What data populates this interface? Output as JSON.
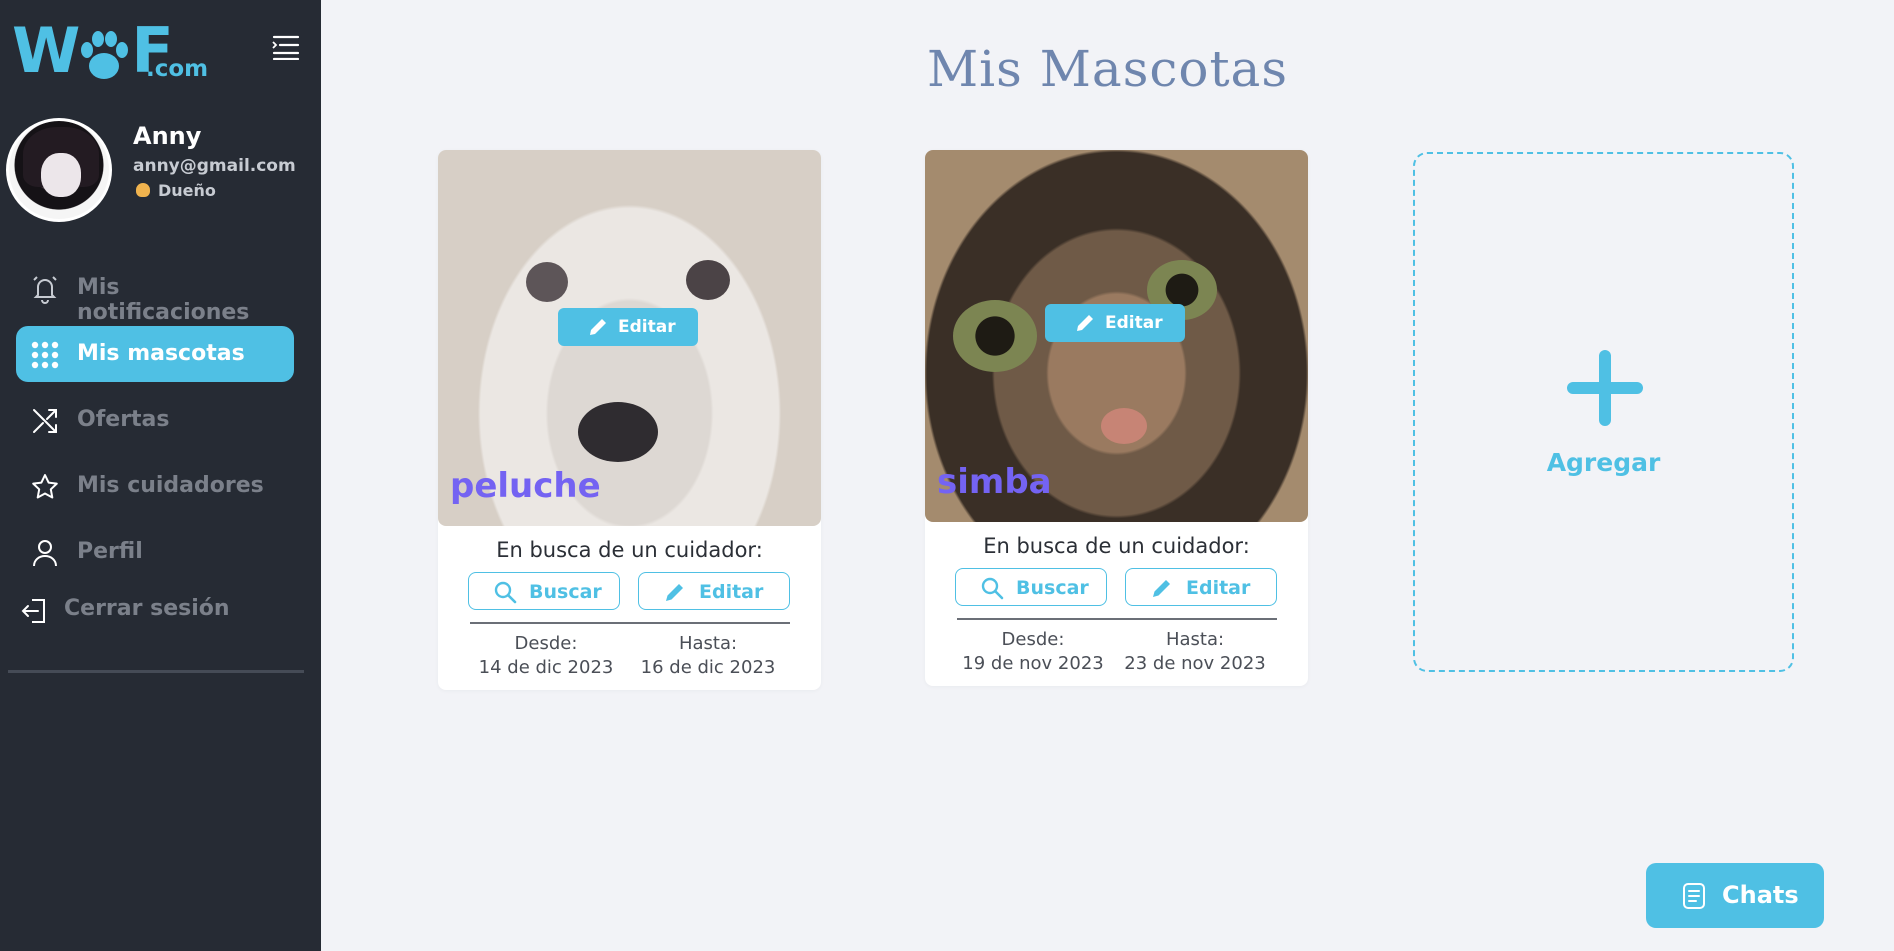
{
  "brand": {
    "logo_main": "WF",
    "logo_domain": ".com",
    "color": "#4fc0e4"
  },
  "user": {
    "name": "Anny",
    "email": "anny@gmail.com",
    "role": "Dueño"
  },
  "nav": {
    "items": [
      {
        "label": "Mis notificaciones",
        "icon": "bell-icon",
        "active": false
      },
      {
        "label": "Mis mascotas",
        "icon": "grid-dots-icon",
        "active": true
      },
      {
        "label": "Ofertas",
        "icon": "shuffle-icon",
        "active": false
      },
      {
        "label": "Mis cuidadores",
        "icon": "star-icon",
        "active": false
      },
      {
        "label": "Perfil",
        "icon": "user-icon",
        "active": false
      }
    ],
    "logout": "Cerrar sesión"
  },
  "page": {
    "title": "Mis Mascotas"
  },
  "pets": [
    {
      "name": "peluche",
      "photo_edit": "Editar",
      "search_label": "En busca de un cuidador:",
      "search_button": "Buscar",
      "edit_button": "Editar",
      "from_label": "Desde:",
      "from_date": "14 de dic 2023",
      "to_label": "Hasta:",
      "to_date": "16 de dic 2023"
    },
    {
      "name": "simba",
      "photo_edit": "Editar",
      "search_label": "En busca de un cuidador:",
      "search_button": "Buscar",
      "edit_button": "Editar",
      "from_label": "Desde:",
      "from_date": "19 de nov 2023",
      "to_label": "Hasta:",
      "to_date": "23 de nov 2023"
    }
  ],
  "add_card": {
    "label": "Agregar"
  },
  "chats": {
    "label": "Chats"
  },
  "colors": {
    "accent": "#4fc0e4",
    "sidebar": "#262b34",
    "background": "#f2f3f7",
    "pet_name": "#7463f2",
    "title": "#6f86ae"
  }
}
